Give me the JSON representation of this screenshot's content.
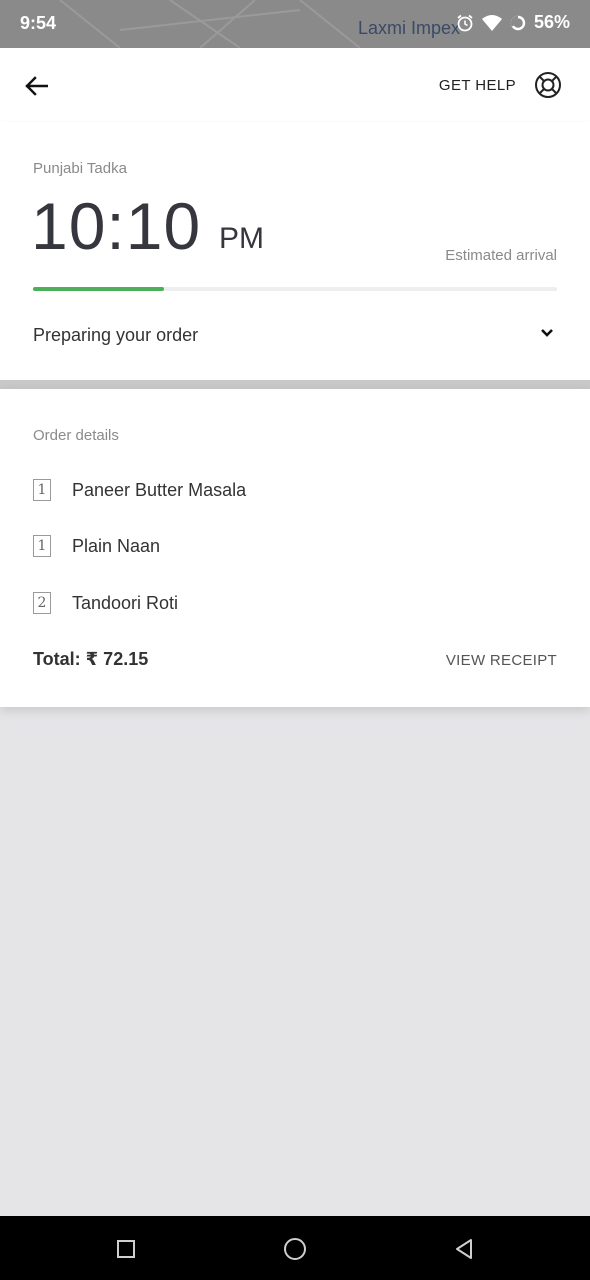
{
  "status_bar": {
    "time": "9:54",
    "carrier": "Laxmi Impex",
    "battery": "56%",
    "icons": [
      "alarm-icon",
      "wifi-icon",
      "battery-ring-icon"
    ]
  },
  "header": {
    "back_icon": "arrow-left-icon",
    "get_help_label": "GET HELP",
    "help_icon": "lifebuoy-icon"
  },
  "order_status": {
    "restaurant": "Punjabi Tadka",
    "eta_time": "10:10",
    "eta_ampm": "PM",
    "eta_label": "Estimated arrival",
    "progress": 0.25,
    "status_text": "Preparing your order",
    "expand_icon": "chevron-down-icon"
  },
  "order_details": {
    "title": "Order details",
    "items": [
      {
        "qty": "1",
        "name": "Paneer Butter Masala"
      },
      {
        "qty": "1",
        "name": "Plain Naan"
      },
      {
        "qty": "2",
        "name": "Tandoori Roti"
      }
    ],
    "total": "Total: ₹ 72.15",
    "view_receipt_label": "VIEW RECEIPT"
  },
  "nav_bar": {
    "icons": [
      "square-recents-icon",
      "circle-home-icon",
      "triangle-back-icon"
    ]
  },
  "colors": {
    "accent_green": "#4caf5a",
    "background": "#e5e5e8",
    "card": "#ffffff"
  }
}
